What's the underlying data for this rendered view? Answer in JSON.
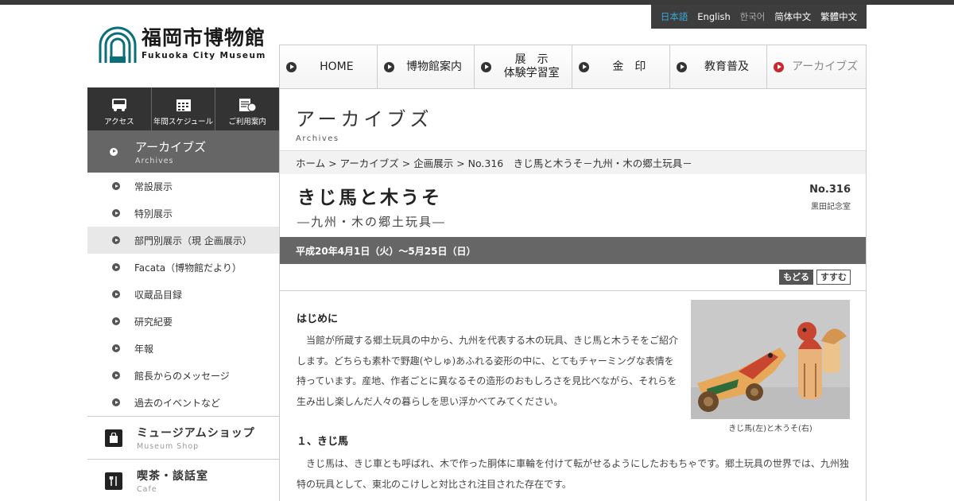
{
  "language_switcher": {
    "items": [
      {
        "label": "日本語",
        "state": "active"
      },
      {
        "label": "English",
        "state": "normal"
      },
      {
        "label": "한국어",
        "state": "dim"
      },
      {
        "label": "简体中文",
        "state": "normal"
      },
      {
        "label": "繁體中文",
        "state": "normal"
      }
    ]
  },
  "logo": {
    "ja": "福岡市博物館",
    "en": "Fukuoka City Museum"
  },
  "quick_links": [
    {
      "label": "アクセス",
      "icon": "bus-icon"
    },
    {
      "label": "年間スケジュール",
      "icon": "calendar-icon"
    },
    {
      "label": "ご利用案内",
      "icon": "guide-icon"
    }
  ],
  "sidebar": {
    "section_title": "アーカイブズ",
    "section_sub": "Archives",
    "items": [
      {
        "label": "常設展示",
        "selected": false
      },
      {
        "label": "特別展示",
        "selected": false
      },
      {
        "label": "部門別展示（現 企画展示）",
        "selected": true
      },
      {
        "label": "Facata（博物館だより）",
        "selected": false
      },
      {
        "label": "収蔵品目録",
        "selected": false
      },
      {
        "label": "研究紀要",
        "selected": false
      },
      {
        "label": "年報",
        "selected": false
      },
      {
        "label": "館長からのメッセージ",
        "selected": false
      },
      {
        "label": "過去のイベントなど",
        "selected": false
      }
    ],
    "shop": {
      "title": "ミュージアムショップ",
      "sub": "Museum Shop"
    },
    "cafe": {
      "title": "喫茶・談話室",
      "sub": "Cafe"
    }
  },
  "global_nav": [
    {
      "label": "HOME"
    },
    {
      "label": "博物館案内"
    },
    {
      "label": "展　示\n体験学習室"
    },
    {
      "label": "金　印"
    },
    {
      "label": "教育普及"
    },
    {
      "label": "アーカイブズ"
    }
  ],
  "page": {
    "title": "アーカイブズ",
    "title_en": "Archives",
    "breadcrumb": "ホーム > アーカイブズ > 企画展示 > No.316　きじ馬と木うそ－九州・木の郷土玩具－"
  },
  "exhibition": {
    "title": "きじ馬と木うそ",
    "subtitle": "―九州・木の郷土玩具―",
    "number": "No.316",
    "room": "黒田記念室",
    "dates": "平成20年4月1日（火）～5月25日（日）"
  },
  "pager": {
    "back": "もどる",
    "next": "すすむ"
  },
  "article": {
    "heading": "はじめに",
    "intro": "当館が所蔵する郷土玩具の中から、九州を代表する木の玩具、きじ馬と木うそをご紹介します。どちらも素朴で野趣(やしゅ)あふれる姿形の中に、とてもチャーミングな表情を持っています。産地、作者ごとに異なるその造形のおもしろさを見比べながら、それらを生み出し楽しんだ人々の暮らしを思い浮かべてみてください。",
    "photo_caption": "きじ馬(左)と木うそ(右)",
    "section2_heading": "１、きじ馬",
    "section2_body": "きじ馬は、きじ車とも呼ばれ、木で作った胴体に車輪を付けて転がせるようにしたおもちゃです。郷土玩具の世界では、九州独特の玩具として、東北のこけしと対比され注目された存在です。"
  }
}
